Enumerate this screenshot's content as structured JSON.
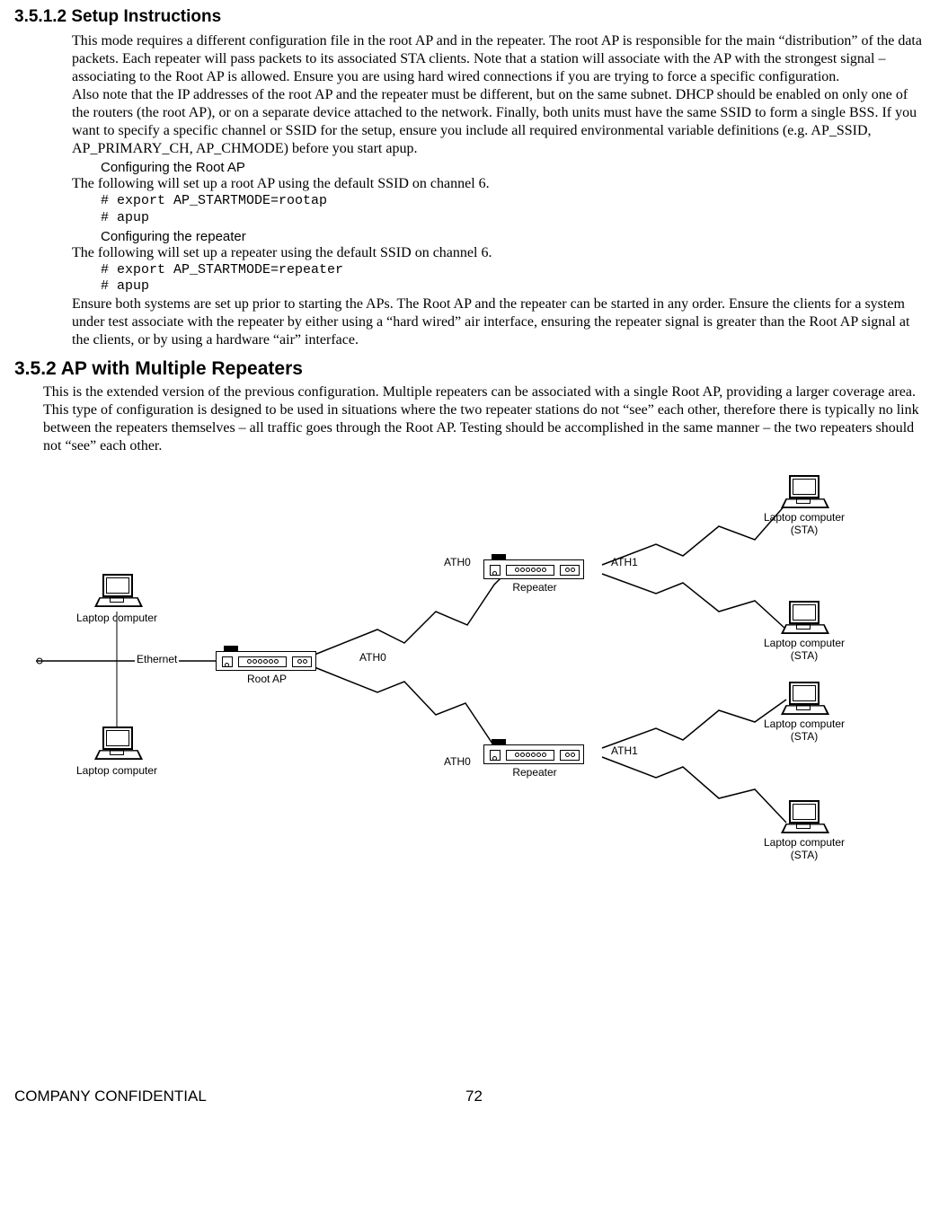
{
  "doc": {
    "h1": "3.5.1.2 Setup Instructions",
    "p1": "This mode requires a different configuration file in the root AP and in the repeater. The root AP is responsible for the main “distribution” of the data packets. Each repeater will pass packets to its associated STA clients. Note that a station will associate with the AP with the strongest signal – associating to the Root AP is allowed. Ensure you are using hard wired connections if you are trying to force a specific configuration.",
    "p2": "Also note that the IP addresses of the root AP and the repeater must be different, but on the same subnet. DHCP should be enabled on only one of the routers (the root AP), or on a separate device attached to the network. Finally, both units must have the same SSID to form a single BSS. If you want to specify a specific channel or SSID for the setup, ensure you include all required environmental variable definitions (e.g. AP_SSID, AP_PRIMARY_CH, AP_CHMODE) before you start apup.",
    "sub1": "Configuring the Root AP",
    "p3": "The following will set up a root AP using the default SSID on channel 6.",
    "code1": "# export AP_STARTMODE=rootap\n# apup",
    "sub2": "Configuring the repeater",
    "p4": "The following will set up a repeater using the default SSID on channel 6.",
    "code2": "# export AP_STARTMODE=repeater\n# apup",
    "p5": "Ensure both systems are set up prior to starting the APs. The Root AP and the repeater can be started in any order. Ensure the clients for a system under test associate with the repeater by either using a “hard wired” air interface, ensuring the repeater signal is greater than the Root AP signal at the clients, or by using a hardware “air” interface.",
    "h2": "3.5.2 AP with Multiple Repeaters",
    "p6": "This is the extended version of the previous configuration. Multiple repeaters can be associated with a single Root AP, providing a larger coverage area. This type of configuration is designed to be used in situations where the two repeater stations do not “see” each other, therefore there is typically no link between the repeaters themselves – all traffic goes through the Root AP. Testing should be accomplished in the same manner – the two repeaters should not “see” each other."
  },
  "diagram": {
    "ethernet": "Ethernet",
    "rootap": "Root AP",
    "repeater": "Repeater",
    "ath0": "ATH0",
    "ath1": "ATH1",
    "laptop": "Laptop computer",
    "laptop_sta": "Laptop computer\n(STA)"
  },
  "footer": {
    "left": "COMPANY CONFIDENTIAL",
    "page": "72"
  }
}
